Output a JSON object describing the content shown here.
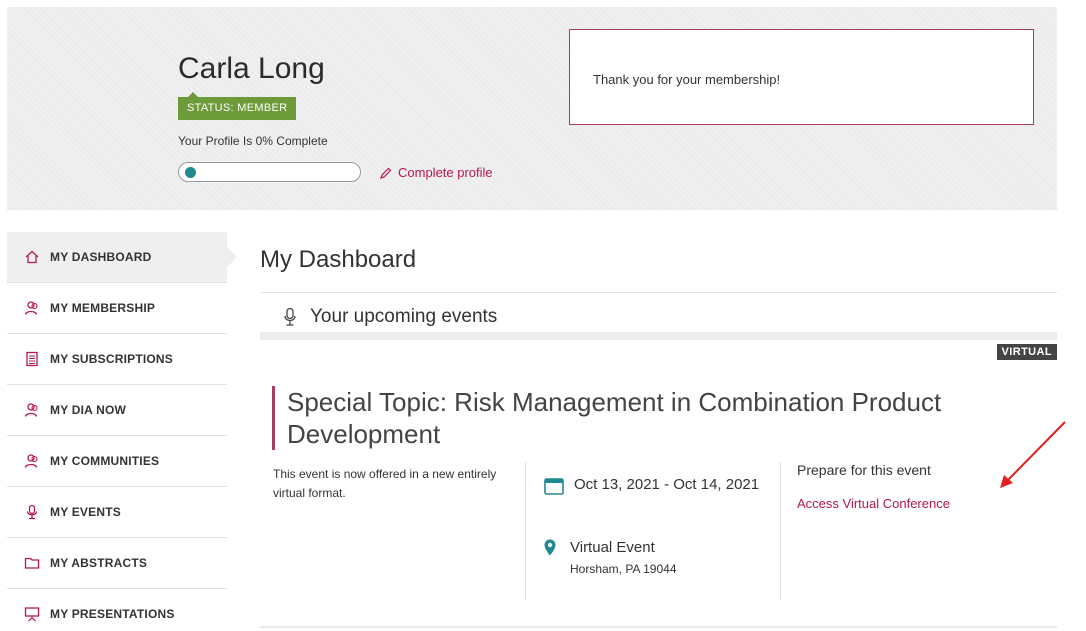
{
  "profile": {
    "name": "Carla Long",
    "status": "STATUS: MEMBER",
    "completion_text": "Your Profile Is 0% Complete",
    "completion_percent": 0,
    "complete_profile_label": "Complete profile",
    "membership_message": "Thank you for your membership!"
  },
  "sidebar": {
    "items": [
      {
        "label": "MY DASHBOARD",
        "icon": "home-icon",
        "active": true
      },
      {
        "label": "MY MEMBERSHIP",
        "icon": "members-icon"
      },
      {
        "label": "MY SUBSCRIPTIONS",
        "icon": "document-icon"
      },
      {
        "label": "MY DIA NOW",
        "icon": "members-icon"
      },
      {
        "label": "MY COMMUNITIES",
        "icon": "members-icon"
      },
      {
        "label": "MY EVENTS",
        "icon": "microphone-icon"
      },
      {
        "label": "MY ABSTRACTS",
        "icon": "folder-icon"
      },
      {
        "label": "MY PRESENTATIONS",
        "icon": "presentation-icon"
      }
    ]
  },
  "main": {
    "title": "My Dashboard",
    "section_title": "Your upcoming events",
    "event": {
      "tag": "VIRTUAL",
      "title": "Special Topic: Risk Management in Combination Product Development",
      "description": "This event is now offered in a new entirely virtual format.",
      "dates": "Oct 13, 2021 - Oct 14, 2021",
      "location_name": "Virtual Event",
      "location_address": "Horsham, PA 19044",
      "prepare_label": "Prepare for this event",
      "access_link": "Access Virtual Conference"
    }
  },
  "colors": {
    "accent": "#b5174f",
    "status_green": "#6d9b3a",
    "progress_teal": "#1e8a8f",
    "annotation_arrow": "#e0201f"
  }
}
